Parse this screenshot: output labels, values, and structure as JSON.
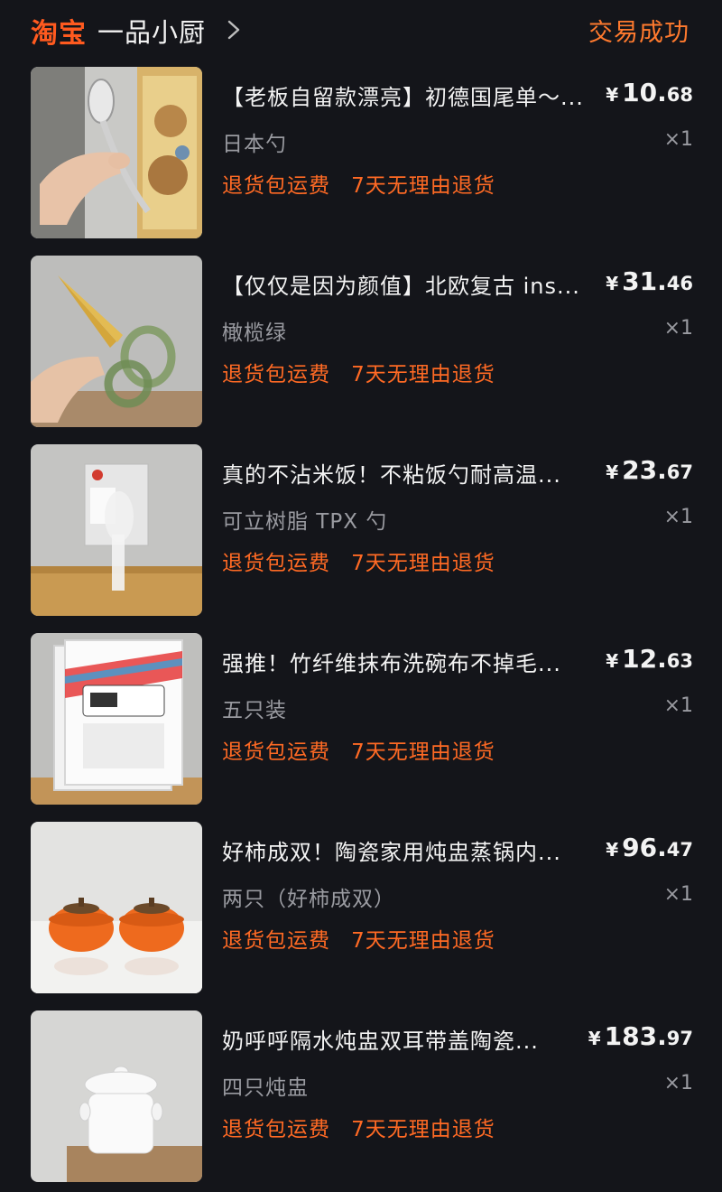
{
  "header": {
    "brand": "淘宝",
    "shop_name": "一品小厨",
    "status": "交易成功",
    "brand_color": "#ff5a1f",
    "status_color": "#ff7a2e"
  },
  "items": [
    {
      "title": "【老板自留款漂亮】初德国尾单～...",
      "price_symbol": "¥",
      "price_int": "10.",
      "price_dec": "68",
      "variant": "日本勺",
      "qty": "×1",
      "tags": [
        "退货包运费",
        "7天无理由退货"
      ]
    },
    {
      "title": "【仅仅是因为颜值】北欧复古 ins...",
      "price_symbol": "¥",
      "price_int": "31.",
      "price_dec": "46",
      "variant": "橄榄绿",
      "qty": "×1",
      "tags": [
        "退货包运费",
        "7天无理由退货"
      ]
    },
    {
      "title": "真的不沾米饭！不粘饭勺耐高温...",
      "price_symbol": "¥",
      "price_int": "23.",
      "price_dec": "67",
      "variant": "可立树脂 TPX 勺",
      "qty": "×1",
      "tags": [
        "退货包运费",
        "7天无理由退货"
      ]
    },
    {
      "title": "强推！竹纤维抹布洗碗布不掉毛...",
      "price_symbol": "¥",
      "price_int": "12.",
      "price_dec": "63",
      "variant": "五只装",
      "qty": "×1",
      "tags": [
        "退货包运费",
        "7天无理由退货"
      ]
    },
    {
      "title": "好柿成双！陶瓷家用炖盅蒸锅内...",
      "price_symbol": "¥",
      "price_int": "96.",
      "price_dec": "47",
      "variant": "两只（好柿成双）",
      "qty": "×1",
      "tags": [
        "退货包运费",
        "7天无理由退货"
      ]
    },
    {
      "title": "奶呼呼隔水炖盅双耳带盖陶瓷...",
      "price_symbol": "¥",
      "price_int": "183.",
      "price_dec": "97",
      "variant": "四只炖盅",
      "qty": "×1",
      "tags": [
        "退货包运费",
        "7天无理由退货"
      ]
    }
  ]
}
